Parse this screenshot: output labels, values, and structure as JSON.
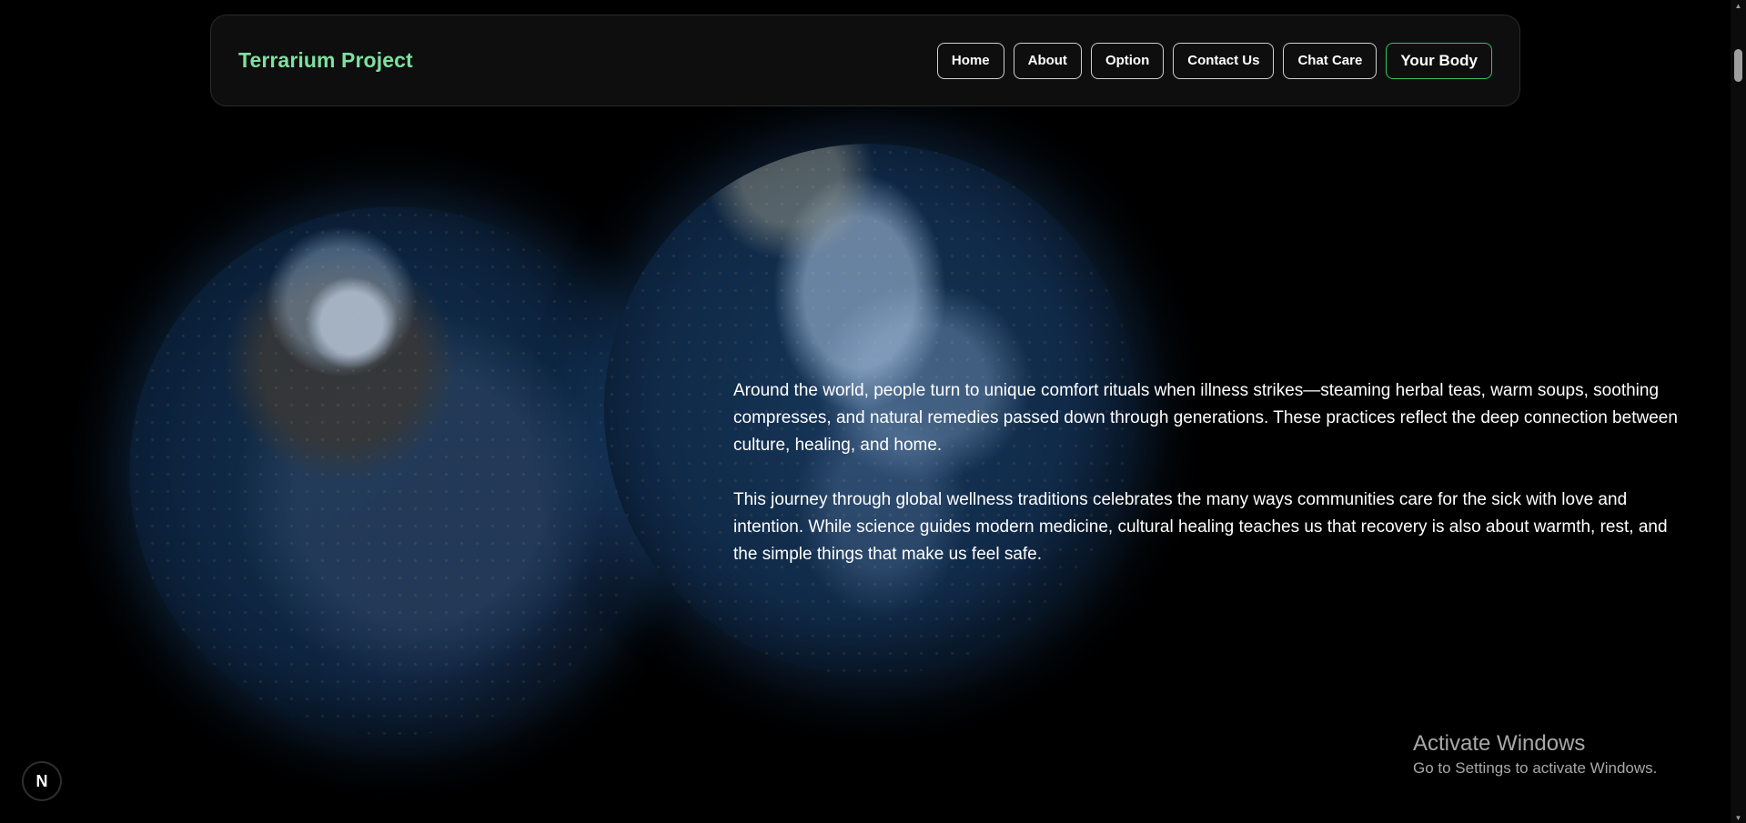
{
  "navbar": {
    "brand": "Terrarium Project",
    "links": [
      {
        "label": "Home"
      },
      {
        "label": "About"
      },
      {
        "label": "Option"
      },
      {
        "label": "Contact Us"
      },
      {
        "label": "Chat Care"
      },
      {
        "label": "Your Body"
      }
    ]
  },
  "content": {
    "paragraphs": [
      "Around the world, people turn to unique comfort rituals when illness strikes—steaming herbal teas, warm soups, soothing compresses, and natural remedies passed down through generations. These practices reflect the deep connection between culture, healing, and home.",
      "This journey through global wellness traditions celebrates the many ways communities care for the sick with love and intention. While science guides modern medicine, cultural healing teaches us that recovery is also about warmth, rest, and the simple things that make us feel safe."
    ]
  },
  "watermark": {
    "title": "Activate Windows",
    "subtitle": "Go to Settings to activate Windows."
  },
  "next_badge": {
    "label": "N"
  },
  "colors": {
    "brand": "#7ee0a0",
    "accent_border": "#33c266",
    "background": "#000000"
  },
  "icons": {
    "next_badge": "nextjs-logo-icon",
    "scroll_up": "scroll-up-arrow-icon",
    "scroll_down": "scroll-down-arrow-icon"
  }
}
